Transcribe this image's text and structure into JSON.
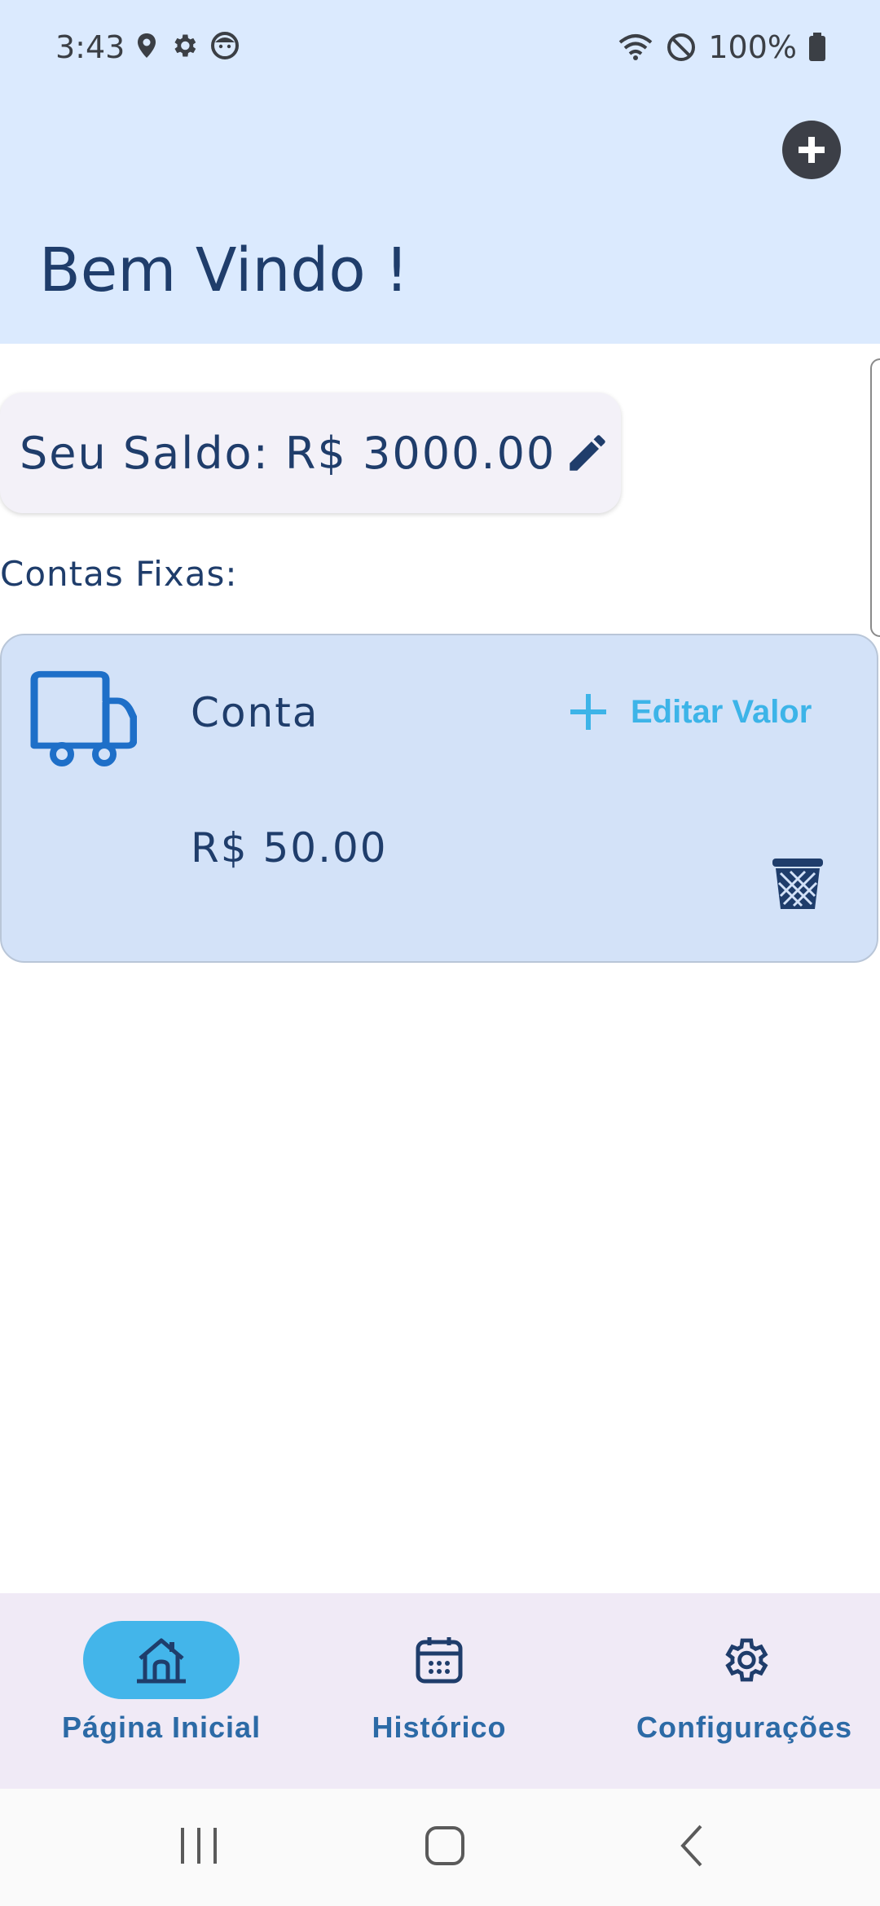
{
  "status_bar": {
    "time": "3:43",
    "battery": "100%",
    "icons_left": [
      "location-icon",
      "settings-icon",
      "face-icon"
    ],
    "icons_right": [
      "wifi-icon",
      "do-not-disturb-icon",
      "battery-icon"
    ]
  },
  "header": {
    "title": "Bem Vindo !",
    "add_icon": "plus-circle-icon"
  },
  "balance": {
    "label": "Seu Saldo: R$ 3000.00",
    "edit_icon": "pencil-icon"
  },
  "fixed_bills": {
    "section_label": "Contas Fixas:",
    "items": [
      {
        "name": "Conta",
        "value": "R$ 50.00",
        "icon": "truck-icon",
        "edit_label": "Editar Valor",
        "delete_icon": "trash-icon"
      }
    ]
  },
  "bottom_nav": {
    "items": [
      {
        "label": "Página Inicial",
        "icon": "home-icon",
        "active": true
      },
      {
        "label": "Histórico",
        "icon": "calendar-icon",
        "active": false
      },
      {
        "label": "Configurações",
        "icon": "gear-icon",
        "active": false
      }
    ]
  },
  "colors": {
    "header_bg": "#dbeafe",
    "primary_text": "#1f3d6b",
    "accent": "#43b5ea",
    "card_bg": "#d3e2f8",
    "nav_bg": "#f0eaf6"
  }
}
